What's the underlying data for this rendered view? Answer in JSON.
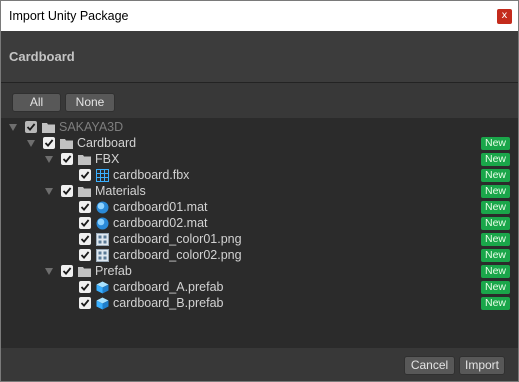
{
  "window": {
    "title": "Import Unity Package",
    "close_symbol": "x"
  },
  "header": {
    "title": "Cardboard"
  },
  "toolbar": {
    "all_label": "All",
    "none_label": "None"
  },
  "tree": {
    "badge_label": "New",
    "rows": [
      {
        "label": "SAKAYA3D",
        "type": "folder",
        "depth": 0,
        "checked": true,
        "dim": true,
        "badge": false
      },
      {
        "label": "Cardboard",
        "type": "folder",
        "depth": 1,
        "checked": true,
        "badge": true
      },
      {
        "label": "FBX",
        "type": "folder",
        "depth": 2,
        "checked": true,
        "badge": true
      },
      {
        "label": "cardboard.fbx",
        "type": "mesh",
        "depth": 3,
        "checked": true,
        "badge": true
      },
      {
        "label": "Materials",
        "type": "folder",
        "depth": 2,
        "checked": true,
        "badge": true
      },
      {
        "label": "cardboard01.mat",
        "type": "material",
        "depth": 3,
        "checked": true,
        "badge": true
      },
      {
        "label": "cardboard02.mat",
        "type": "material",
        "depth": 3,
        "checked": true,
        "badge": true
      },
      {
        "label": "cardboard_color01.png",
        "type": "texture",
        "depth": 3,
        "checked": true,
        "badge": true
      },
      {
        "label": "cardboard_color02.png",
        "type": "texture",
        "depth": 3,
        "checked": true,
        "badge": true
      },
      {
        "label": "Prefab",
        "type": "folder",
        "depth": 2,
        "checked": true,
        "badge": true
      },
      {
        "label": "cardboard_A.prefab",
        "type": "prefab",
        "depth": 3,
        "checked": true,
        "badge": true
      },
      {
        "label": "cardboard_B.prefab",
        "type": "prefab",
        "depth": 3,
        "checked": true,
        "badge": true
      }
    ]
  },
  "footer": {
    "cancel_label": "Cancel",
    "import_label": "Import"
  },
  "colors": {
    "badge_green": "#1aa64a",
    "close_red": "#c42b1c",
    "asset_blue": "#3ab0ff"
  }
}
